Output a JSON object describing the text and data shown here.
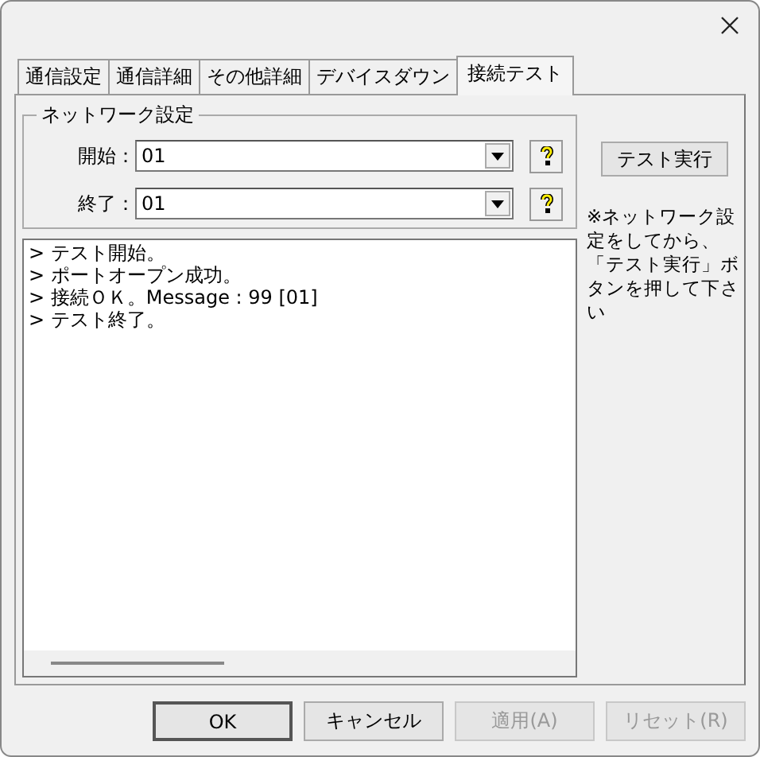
{
  "tabs": [
    {
      "label": "通信設定",
      "selected": false
    },
    {
      "label": "通信詳細",
      "selected": false
    },
    {
      "label": "その他詳細",
      "selected": false
    },
    {
      "label": "デバイスダウン",
      "selected": false
    },
    {
      "label": "接続テスト",
      "selected": true
    }
  ],
  "network_group": {
    "title": "ネットワーク設定",
    "fields": [
      {
        "label": "開始：",
        "value": "01"
      },
      {
        "label": "終了：",
        "value": "01"
      }
    ]
  },
  "test_button": {
    "label": "テスト実行"
  },
  "note": "※ネットワーク設定をしてから、「テスト実行」ボタンを押して下さい",
  "log": [
    "> テスト開始。",
    "> ポートオープン成功。",
    "> 接続ＯＫ。Message : 99 [01]",
    "> テスト終了。"
  ],
  "buttons": [
    {
      "label": "OK",
      "disabled": false,
      "default": true
    },
    {
      "label": "キャンセル",
      "disabled": false,
      "default": false
    },
    {
      "label": "適用(A)",
      "disabled": true,
      "default": false
    },
    {
      "label": "リセット(R)",
      "disabled": true,
      "default": false
    }
  ]
}
